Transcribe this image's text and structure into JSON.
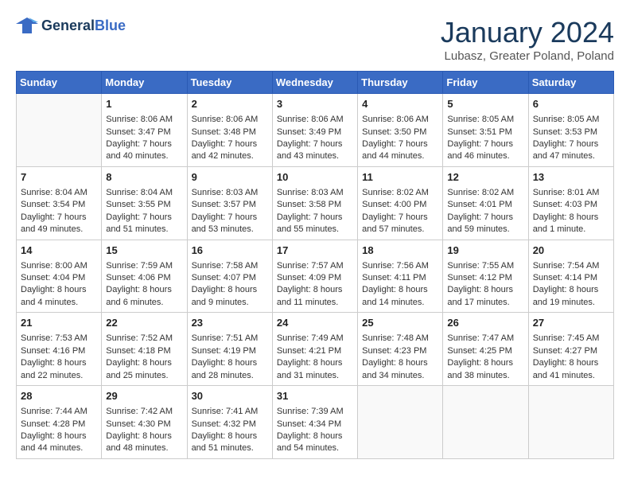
{
  "logo": {
    "line1": "General",
    "line2": "Blue"
  },
  "title": "January 2024",
  "location": "Lubasz, Greater Poland, Poland",
  "days_header": [
    "Sunday",
    "Monday",
    "Tuesday",
    "Wednesday",
    "Thursday",
    "Friday",
    "Saturday"
  ],
  "weeks": [
    [
      {
        "day": "",
        "sunrise": "",
        "sunset": "",
        "daylight": ""
      },
      {
        "day": "1",
        "sunrise": "Sunrise: 8:06 AM",
        "sunset": "Sunset: 3:47 PM",
        "daylight": "Daylight: 7 hours and 40 minutes."
      },
      {
        "day": "2",
        "sunrise": "Sunrise: 8:06 AM",
        "sunset": "Sunset: 3:48 PM",
        "daylight": "Daylight: 7 hours and 42 minutes."
      },
      {
        "day": "3",
        "sunrise": "Sunrise: 8:06 AM",
        "sunset": "Sunset: 3:49 PM",
        "daylight": "Daylight: 7 hours and 43 minutes."
      },
      {
        "day": "4",
        "sunrise": "Sunrise: 8:06 AM",
        "sunset": "Sunset: 3:50 PM",
        "daylight": "Daylight: 7 hours and 44 minutes."
      },
      {
        "day": "5",
        "sunrise": "Sunrise: 8:05 AM",
        "sunset": "Sunset: 3:51 PM",
        "daylight": "Daylight: 7 hours and 46 minutes."
      },
      {
        "day": "6",
        "sunrise": "Sunrise: 8:05 AM",
        "sunset": "Sunset: 3:53 PM",
        "daylight": "Daylight: 7 hours and 47 minutes."
      }
    ],
    [
      {
        "day": "7",
        "sunrise": "Sunrise: 8:04 AM",
        "sunset": "Sunset: 3:54 PM",
        "daylight": "Daylight: 7 hours and 49 minutes."
      },
      {
        "day": "8",
        "sunrise": "Sunrise: 8:04 AM",
        "sunset": "Sunset: 3:55 PM",
        "daylight": "Daylight: 7 hours and 51 minutes."
      },
      {
        "day": "9",
        "sunrise": "Sunrise: 8:03 AM",
        "sunset": "Sunset: 3:57 PM",
        "daylight": "Daylight: 7 hours and 53 minutes."
      },
      {
        "day": "10",
        "sunrise": "Sunrise: 8:03 AM",
        "sunset": "Sunset: 3:58 PM",
        "daylight": "Daylight: 7 hours and 55 minutes."
      },
      {
        "day": "11",
        "sunrise": "Sunrise: 8:02 AM",
        "sunset": "Sunset: 4:00 PM",
        "daylight": "Daylight: 7 hours and 57 minutes."
      },
      {
        "day": "12",
        "sunrise": "Sunrise: 8:02 AM",
        "sunset": "Sunset: 4:01 PM",
        "daylight": "Daylight: 7 hours and 59 minutes."
      },
      {
        "day": "13",
        "sunrise": "Sunrise: 8:01 AM",
        "sunset": "Sunset: 4:03 PM",
        "daylight": "Daylight: 8 hours and 1 minute."
      }
    ],
    [
      {
        "day": "14",
        "sunrise": "Sunrise: 8:00 AM",
        "sunset": "Sunset: 4:04 PM",
        "daylight": "Daylight: 8 hours and 4 minutes."
      },
      {
        "day": "15",
        "sunrise": "Sunrise: 7:59 AM",
        "sunset": "Sunset: 4:06 PM",
        "daylight": "Daylight: 8 hours and 6 minutes."
      },
      {
        "day": "16",
        "sunrise": "Sunrise: 7:58 AM",
        "sunset": "Sunset: 4:07 PM",
        "daylight": "Daylight: 8 hours and 9 minutes."
      },
      {
        "day": "17",
        "sunrise": "Sunrise: 7:57 AM",
        "sunset": "Sunset: 4:09 PM",
        "daylight": "Daylight: 8 hours and 11 minutes."
      },
      {
        "day": "18",
        "sunrise": "Sunrise: 7:56 AM",
        "sunset": "Sunset: 4:11 PM",
        "daylight": "Daylight: 8 hours and 14 minutes."
      },
      {
        "day": "19",
        "sunrise": "Sunrise: 7:55 AM",
        "sunset": "Sunset: 4:12 PM",
        "daylight": "Daylight: 8 hours and 17 minutes."
      },
      {
        "day": "20",
        "sunrise": "Sunrise: 7:54 AM",
        "sunset": "Sunset: 4:14 PM",
        "daylight": "Daylight: 8 hours and 19 minutes."
      }
    ],
    [
      {
        "day": "21",
        "sunrise": "Sunrise: 7:53 AM",
        "sunset": "Sunset: 4:16 PM",
        "daylight": "Daylight: 8 hours and 22 minutes."
      },
      {
        "day": "22",
        "sunrise": "Sunrise: 7:52 AM",
        "sunset": "Sunset: 4:18 PM",
        "daylight": "Daylight: 8 hours and 25 minutes."
      },
      {
        "day": "23",
        "sunrise": "Sunrise: 7:51 AM",
        "sunset": "Sunset: 4:19 PM",
        "daylight": "Daylight: 8 hours and 28 minutes."
      },
      {
        "day": "24",
        "sunrise": "Sunrise: 7:49 AM",
        "sunset": "Sunset: 4:21 PM",
        "daylight": "Daylight: 8 hours and 31 minutes."
      },
      {
        "day": "25",
        "sunrise": "Sunrise: 7:48 AM",
        "sunset": "Sunset: 4:23 PM",
        "daylight": "Daylight: 8 hours and 34 minutes."
      },
      {
        "day": "26",
        "sunrise": "Sunrise: 7:47 AM",
        "sunset": "Sunset: 4:25 PM",
        "daylight": "Daylight: 8 hours and 38 minutes."
      },
      {
        "day": "27",
        "sunrise": "Sunrise: 7:45 AM",
        "sunset": "Sunset: 4:27 PM",
        "daylight": "Daylight: 8 hours and 41 minutes."
      }
    ],
    [
      {
        "day": "28",
        "sunrise": "Sunrise: 7:44 AM",
        "sunset": "Sunset: 4:28 PM",
        "daylight": "Daylight: 8 hours and 44 minutes."
      },
      {
        "day": "29",
        "sunrise": "Sunrise: 7:42 AM",
        "sunset": "Sunset: 4:30 PM",
        "daylight": "Daylight: 8 hours and 48 minutes."
      },
      {
        "day": "30",
        "sunrise": "Sunrise: 7:41 AM",
        "sunset": "Sunset: 4:32 PM",
        "daylight": "Daylight: 8 hours and 51 minutes."
      },
      {
        "day": "31",
        "sunrise": "Sunrise: 7:39 AM",
        "sunset": "Sunset: 4:34 PM",
        "daylight": "Daylight: 8 hours and 54 minutes."
      },
      {
        "day": "",
        "sunrise": "",
        "sunset": "",
        "daylight": ""
      },
      {
        "day": "",
        "sunrise": "",
        "sunset": "",
        "daylight": ""
      },
      {
        "day": "",
        "sunrise": "",
        "sunset": "",
        "daylight": ""
      }
    ]
  ]
}
